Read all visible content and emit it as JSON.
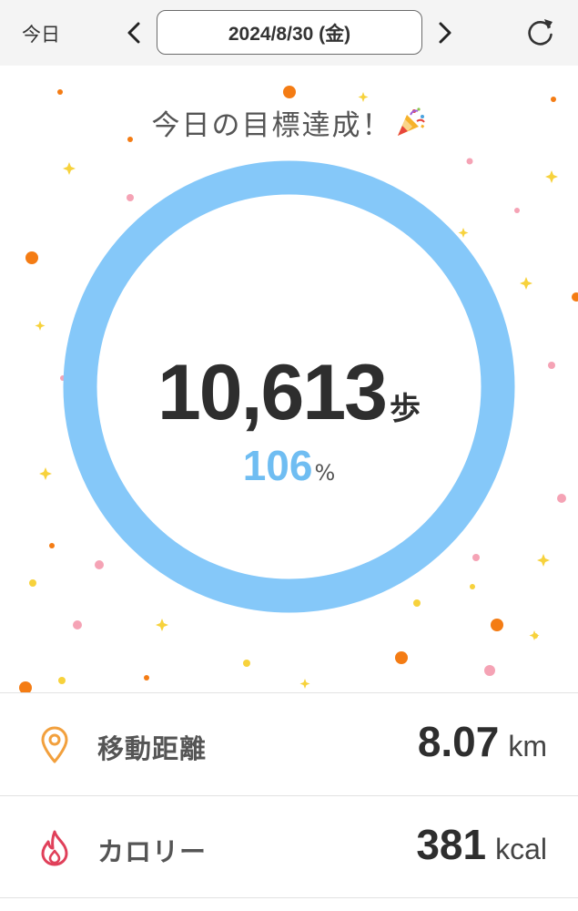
{
  "header": {
    "today_label": "今日",
    "date": "2024/8/30 (金)",
    "prev_icon": "chevron-left-icon",
    "next_icon": "chevron-right-icon",
    "refresh_icon": "refresh-icon"
  },
  "goal": {
    "title": "今日の目標達成！",
    "title_icon": "party-popper-icon",
    "steps": "10,613",
    "steps_unit": "歩",
    "percent": "106",
    "percent_unit": "%",
    "progress_fraction": 1.06
  },
  "stats": [
    {
      "icon": "location-pin-icon",
      "label": "移動距離",
      "value": "8.07",
      "unit": "km"
    },
    {
      "icon": "flame-icon",
      "label": "カロリー",
      "value": "381",
      "unit": "kcal"
    }
  ],
  "colors": {
    "ring": "#85c8f9",
    "percent": "#6fbdf2",
    "confetti_orange": "#f47c14",
    "confetti_pink": "#f5a3b5",
    "confetti_yellow": "#f7d23c",
    "pin_icon": "#f2a03d",
    "flame_icon": "#e0405a"
  }
}
